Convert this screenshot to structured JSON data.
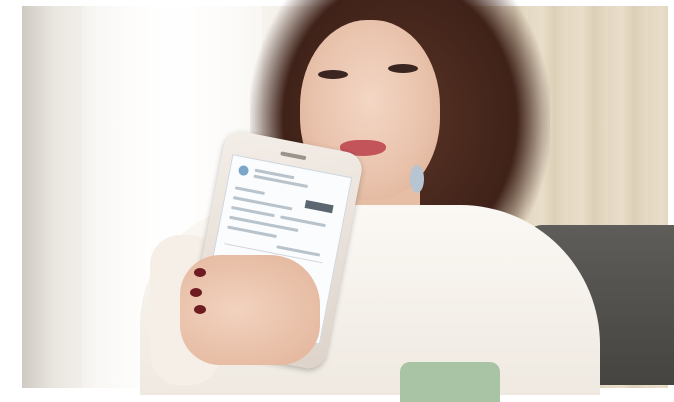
{
  "scene": {
    "colors": {
      "hair": "#3f2219",
      "skin": "#e8c1aa",
      "shirt": "#fbf8f4",
      "lips": "#c2545a",
      "nail_polish": "#6e1b22",
      "phone_body": "#ece4dc",
      "mug": "#a9c4a4",
      "sofa": "#4f4e4a"
    }
  }
}
